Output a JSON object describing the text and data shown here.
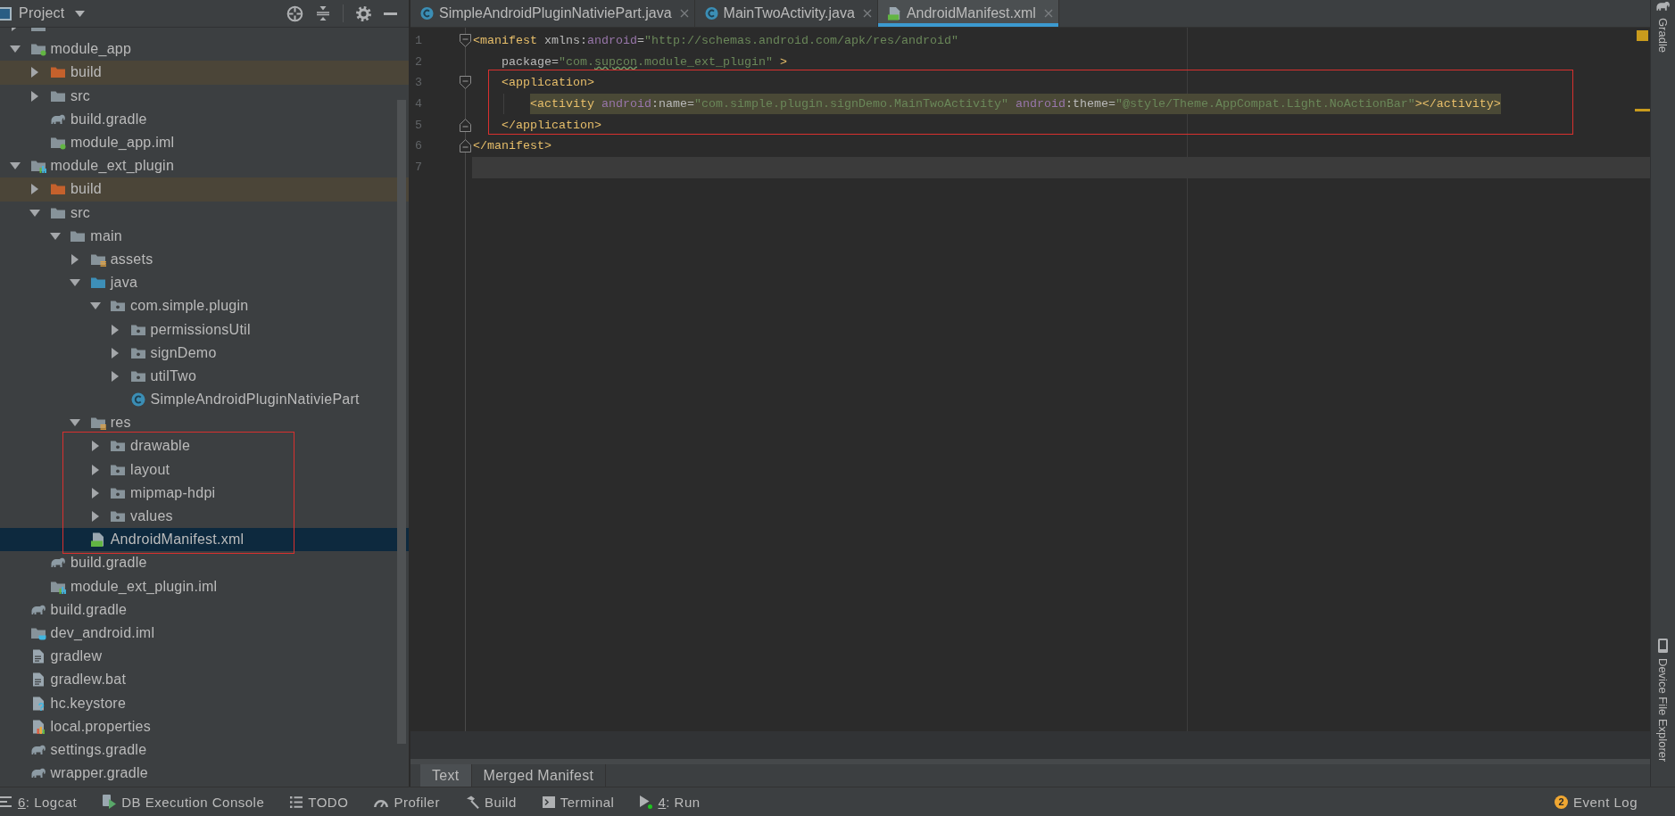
{
  "project_panel": {
    "title": "Project",
    "tree": [
      {
        "kind": "folder",
        "expanded": false,
        "selected": false,
        "framed": false
      },
      {
        "label": "module_app",
        "kind": "module",
        "expanded": true,
        "selected": false,
        "framed": false,
        "children": [
          {
            "label": "build",
            "kind": "excluded",
            "expanded": false,
            "selected": false,
            "framed": false
          },
          {
            "label": "src",
            "kind": "folder",
            "expanded": false,
            "selected": false,
            "framed": false
          },
          {
            "label": "build.gradle",
            "kind": "gradle",
            "selected": false,
            "framed": false
          },
          {
            "label": "module_app.iml",
            "kind": "module",
            "selected": false,
            "framed": false
          }
        ]
      },
      {
        "label": "module_ext_plugin",
        "kind": "library",
        "expanded": true,
        "selected": false,
        "framed": false,
        "children": [
          {
            "label": "build",
            "kind": "excluded",
            "expanded": false,
            "selected": false,
            "framed": false
          },
          {
            "label": "src",
            "kind": "folder",
            "expanded": true,
            "selected": false,
            "framed": false,
            "children": [
              {
                "label": "main",
                "kind": "folder",
                "expanded": true,
                "selected": false,
                "framed": false,
                "children": [
                  {
                    "label": "assets",
                    "kind": "resources",
                    "expanded": false,
                    "selected": false,
                    "framed": false
                  },
                  {
                    "label": "java",
                    "kind": "sources",
                    "expanded": true,
                    "selected": false,
                    "framed": false,
                    "children": [
                      {
                        "label": "com.simple.plugin",
                        "kind": "package",
                        "expanded": true,
                        "selected": false,
                        "framed": false,
                        "children": [
                          {
                            "label": "permissionsUtil",
                            "kind": "package",
                            "expanded": false,
                            "selected": false,
                            "framed": false
                          },
                          {
                            "label": "signDemo",
                            "kind": "package",
                            "expanded": false,
                            "selected": false,
                            "framed": false
                          },
                          {
                            "label": "utilTwo",
                            "kind": "package",
                            "expanded": false,
                            "selected": false,
                            "framed": false
                          },
                          {
                            "label": "SimpleAndroidPluginNativiePart",
                            "kind": "class",
                            "selected": false,
                            "framed": false
                          }
                        ]
                      }
                    ]
                  },
                  {
                    "label": "res",
                    "kind": "resources",
                    "expanded": true,
                    "selected": false,
                    "framed": false,
                    "children": [
                      {
                        "label": "drawable",
                        "kind": "package",
                        "expanded": false,
                        "selected": false,
                        "framed": true
                      },
                      {
                        "label": "layout",
                        "kind": "package",
                        "expanded": false,
                        "selected": false,
                        "framed": true
                      },
                      {
                        "label": "mipmap-hdpi",
                        "kind": "package",
                        "expanded": false,
                        "selected": false,
                        "framed": true
                      },
                      {
                        "label": "values",
                        "kind": "package",
                        "expanded": false,
                        "selected": false,
                        "framed": true
                      }
                    ]
                  },
                  {
                    "label": "AndroidManifest.xml",
                    "kind": "manifest",
                    "selected": true,
                    "framed": true
                  }
                ]
              }
            ]
          },
          {
            "label": "build.gradle",
            "kind": "gradle",
            "selected": false,
            "framed": false
          },
          {
            "label": "module_ext_plugin.iml",
            "kind": "library",
            "selected": false,
            "framed": false
          }
        ]
      },
      {
        "label": "build.gradle",
        "kind": "gradle",
        "selected": false,
        "framed": false
      },
      {
        "label": "dev_android.iml",
        "kind": "javamodule",
        "selected": false,
        "framed": false
      },
      {
        "label": "gradlew",
        "kind": "script",
        "selected": false,
        "framed": false
      },
      {
        "label": "gradlew.bat",
        "kind": "script",
        "selected": false,
        "framed": false
      },
      {
        "label": "hc.keystore",
        "kind": "unknown",
        "selected": false,
        "framed": false
      },
      {
        "label": "local.properties",
        "kind": "properties",
        "selected": false,
        "framed": false
      },
      {
        "label": "settings.gradle",
        "kind": "gradle",
        "selected": false,
        "framed": false
      },
      {
        "label": "wrapper.gradle",
        "kind": "gradle",
        "selected": false,
        "framed": false
      }
    ]
  },
  "editor": {
    "tabs": [
      {
        "label": "SimpleAndroidPluginNativiePart.java",
        "kind": "class",
        "selected": false
      },
      {
        "label": "MainTwoActivity.java",
        "kind": "class",
        "selected": false
      },
      {
        "label": "AndroidManifest.xml",
        "kind": "manifest",
        "selected": true
      }
    ],
    "lines": [
      {
        "number": "1",
        "fold_open": true,
        "fold_close": false,
        "current": false,
        "highlighted": false,
        "framed": false,
        "tokens": [
          {
            "kind": "tag",
            "text": "<manifest"
          },
          {
            "kind": "attr",
            "text": " xmlns:"
          },
          {
            "kind": "ns",
            "text": "android"
          },
          {
            "kind": "attr",
            "text": "="
          },
          {
            "kind": "string",
            "text": "\"http://schemas.android.com/apk/res/android\""
          }
        ]
      },
      {
        "number": "2",
        "fold_open": false,
        "fold_close": false,
        "current": false,
        "highlighted": false,
        "framed": false,
        "tokens": [
          {
            "kind": "attr",
            "text": "    package="
          },
          {
            "kind": "string",
            "text": "\"com."
          },
          {
            "kind": "typo",
            "text": "supcon"
          },
          {
            "kind": "string",
            "text": ".module_ext_plugin\""
          },
          {
            "kind": "tag",
            "text": " >"
          }
        ]
      },
      {
        "number": "3",
        "fold_open": true,
        "fold_close": false,
        "current": false,
        "highlighted": false,
        "framed": true,
        "tokens": [
          {
            "kind": "tag",
            "text": "    <application>"
          }
        ]
      },
      {
        "number": "4",
        "fold_open": false,
        "fold_close": false,
        "current": false,
        "highlighted": true,
        "framed": true,
        "tokens": [
          {
            "kind": "tag",
            "text": "        <activity"
          },
          {
            "kind": "ns",
            "text": " android"
          },
          {
            "kind": "attr",
            "text": ":name="
          },
          {
            "kind": "string",
            "text": "\"com.simple.plugin.signDemo.MainTwoActivity\""
          },
          {
            "kind": "ns",
            "text": " android"
          },
          {
            "kind": "attr",
            "text": ":theme="
          },
          {
            "kind": "string",
            "text": "\"@style/Theme.AppCompat.Light.NoActionBar\""
          },
          {
            "kind": "tag",
            "text": "></activity>"
          }
        ]
      },
      {
        "number": "5",
        "fold_open": false,
        "fold_close": true,
        "current": false,
        "highlighted": false,
        "framed": true,
        "tokens": [
          {
            "kind": "tag",
            "text": "    </application>"
          }
        ]
      },
      {
        "number": "6",
        "fold_open": false,
        "fold_close": true,
        "current": false,
        "highlighted": false,
        "framed": false,
        "tokens": [
          {
            "kind": "tag",
            "text": "</manifest>"
          }
        ]
      },
      {
        "number": "7",
        "fold_open": false,
        "fold_close": false,
        "current": true,
        "framed": false
      }
    ],
    "view_tabs": [
      {
        "label": "Text",
        "selected": true
      },
      {
        "label": "Merged Manifest",
        "selected": false
      }
    ]
  },
  "right_strip": {
    "tools": [
      {
        "label": "Gradle",
        "kind": "gradle"
      },
      {
        "label": "Device File Explorer",
        "kind": "device"
      }
    ]
  },
  "tool_bar": {
    "tools": [
      {
        "label": "6: Logcat",
        "kind": "logcat",
        "underlined_key": true
      },
      {
        "label": "DB Execution Console",
        "kind": "database",
        "underlined_key": false
      },
      {
        "label": "TODO",
        "kind": "todo",
        "underlined_key": false
      },
      {
        "label": "Profiler",
        "kind": "profiler",
        "underlined_key": false
      },
      {
        "label": "Build",
        "kind": "build",
        "underlined_key": false
      },
      {
        "label": "Terminal",
        "kind": "terminal",
        "underlined_key": false
      },
      {
        "label": "4: Run",
        "kind": "run",
        "underlined_key": true
      }
    ],
    "event_log": {
      "label": "Event Log",
      "badge": "2"
    }
  }
}
